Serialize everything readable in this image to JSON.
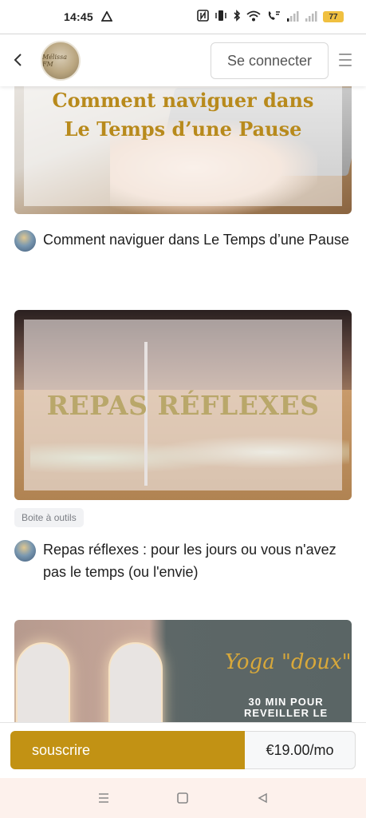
{
  "status_bar": {
    "time": "14:45",
    "battery": "77",
    "icons": [
      "drive-icon",
      "nfc-icon",
      "vibrate-icon",
      "bluetooth-icon",
      "wifi-icon",
      "volte-call-icon",
      "signal-icon",
      "signal-icon",
      "battery-icon"
    ]
  },
  "header": {
    "logo_text": "Mélissa FM",
    "login_label": "Se connecter",
    "icons": [
      "back-arrow-icon",
      "hamburger-menu-icon"
    ]
  },
  "posts": [
    {
      "image_overlay_text": [
        "Comment naviguer dans",
        "Le Temps d’une Pause"
      ],
      "title": "Comment naviguer dans Le Temps d’une Pause",
      "tag": ""
    },
    {
      "image_overlay_text": [
        "REPAS RÉFLEXES"
      ],
      "tag": "Boite à outils",
      "title": "Repas réflexes : pour les jours ou vous n'avez pas le temps (ou l'envie)"
    },
    {
      "image_overlay_text": [
        "Yoga \"doux\"",
        "30 MIN POUR",
        "REVEILLER LE"
      ],
      "title": "",
      "tag": ""
    }
  ],
  "subscribe": {
    "button_label": "souscrire",
    "price": "€19.00/mo",
    "accent_color": "#c29214"
  },
  "nav_bar": {
    "icons": [
      "recent-apps-icon",
      "home-icon",
      "back-icon"
    ]
  }
}
